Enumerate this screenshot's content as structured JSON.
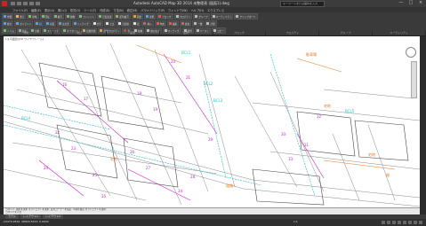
{
  "window": {
    "title": "Autodesk AutoCAD Map 3D 2014  未整理表  (図面1).dwg",
    "search_placeholder": "キーワードまたは語句を入力",
    "controls": [
      "—",
      "□",
      "×"
    ]
  },
  "menu": [
    "ファイル(F)",
    "編集(E)",
    "表示(V)",
    "挿入(I)",
    "形式(O)",
    "ツール(T)",
    "作成(D)",
    "寸法(N)",
    "修正(M)",
    "パラメトリック(P)",
    "ウィンドウ(W)",
    "ヘルプ(H)",
    "エクスプレス"
  ],
  "ribbon": {
    "row1": [
      "作図",
      "修正",
      "移動",
      "回転",
      "複写",
      "鏡像",
      "フィレット",
      "尺度変更",
      "配列複写",
      "画層",
      "注釈",
      "ブロック",
      "プロパティ",
      "グループ",
      "ユーティリティ",
      "クリップボード"
    ],
    "row2": [
      "線分",
      "ポリライン",
      "円",
      "円弧",
      "長方形",
      "ハッチング",
      "文字",
      "寸法",
      "引出線",
      "表",
      "挿入",
      "作成",
      "編集",
      "属性",
      "一致",
      "計測"
    ],
    "row3": [
      "トリム",
      "延長",
      "分解",
      "ストレッチ",
      "オフセット",
      "画層状態",
      "画層プロパティ",
      "色",
      "線種",
      "線の太さ",
      "マッチング",
      "選択",
      "ペースト",
      "コピー"
    ],
    "panels": [
      "作成",
      "修正",
      "画層",
      "注釈",
      "ブロック",
      "プロパティ",
      "グループ",
      "ユーティリティ"
    ]
  },
  "viewport": {
    "label": "[-][平面図][2D ワイヤフレーム]"
  },
  "drawing_labels": {
    "magenta": [
      "16",
      "17",
      "18",
      "19",
      "20",
      "21",
      "22",
      "23",
      "24",
      "25",
      "26",
      "27",
      "28",
      "29",
      "30",
      "31",
      "32",
      "33",
      "34",
      "35"
    ],
    "orange": [
      "駐車場",
      "宅地",
      "畑",
      "宅地",
      "道路",
      "宅地"
    ],
    "cyan": [
      "BCL1",
      "BCL2",
      "BCL3",
      "BCL4",
      "BCL5"
    ]
  },
  "command_line": {
    "history": "コマンド: 図形を選択  オブジェクトを選択: 反対コーナーを指定: 3 個を検出  オブジェクトを選択:",
    "prompt": "コマンドを入力"
  },
  "layout_tabs": [
    "モデル",
    "レイアウト1",
    "レイアウト2"
  ],
  "status": {
    "coords": "-23476.2816, 48820.5433, 0.0000",
    "scale": "1:1"
  },
  "colors": {
    "magenta": "#d020d0",
    "orange": "#e07820",
    "cyan": "#30b8c8",
    "linework": "#666666"
  }
}
